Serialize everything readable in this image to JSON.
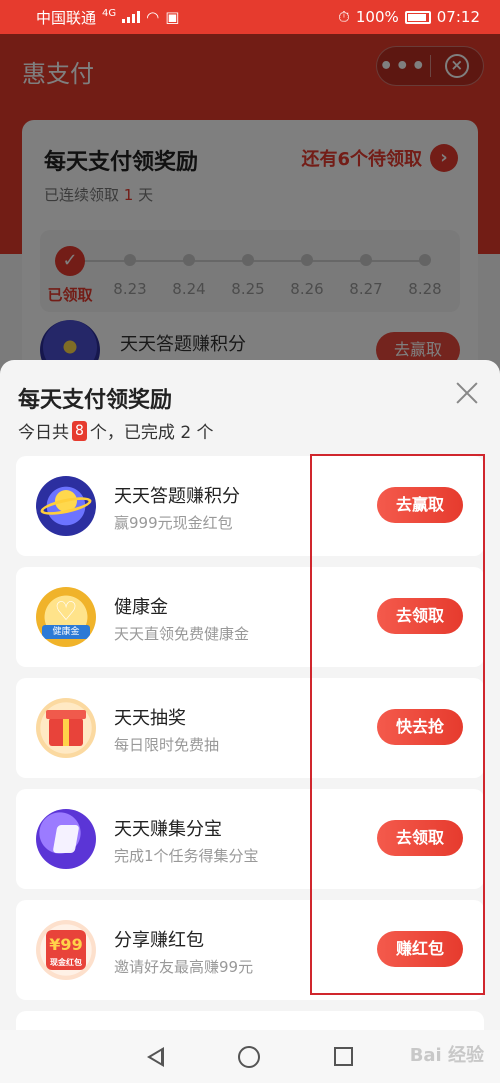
{
  "status_bar": {
    "carrier": "中国联通",
    "network": "4G",
    "battery": "100%",
    "time": "07:12"
  },
  "background_page": {
    "title": "惠支付",
    "card": {
      "title": "每天支付领奖励",
      "pending": "还有6个待领取",
      "streak_prefix": "已连续领取",
      "streak_days": "1",
      "streak_suffix": "天",
      "timeline": [
        {
          "label": "已领取",
          "done": true
        },
        {
          "label": "8.23",
          "done": false
        },
        {
          "label": "8.24",
          "done": false
        },
        {
          "label": "8.25",
          "done": false
        },
        {
          "label": "8.26",
          "done": false
        },
        {
          "label": "8.27",
          "done": false
        },
        {
          "label": "8.28",
          "done": false
        }
      ],
      "row": {
        "title": "天天答题赚积分",
        "button": "去赢取"
      }
    }
  },
  "sheet": {
    "title": "每天支付领奖励",
    "summary_prefix": "今日共",
    "summary_count": "8",
    "summary_suffix": "个，已完成 2 个",
    "tasks": [
      {
        "icon": "planet-icon",
        "title": "天天答题赚积分",
        "desc": "赢999元现金红包",
        "button": "去赢取"
      },
      {
        "icon": "health-coin-icon",
        "title": "健康金",
        "desc": "天天直领免费健康金",
        "button": "去领取",
        "icon_tag": "健康金"
      },
      {
        "icon": "gift-box-icon",
        "title": "天天抽奖",
        "desc": "每日限时免费抽",
        "button": "快去抢"
      },
      {
        "icon": "treasure-icon",
        "title": "天天赚集分宝",
        "desc": "完成1个任务得集分宝",
        "button": "去领取"
      },
      {
        "icon": "red-packet-icon",
        "title": "分享赚红包",
        "desc": "邀请好友最高赚99元",
        "button": "赚红包",
        "icon_text": "¥99",
        "icon_tag": "现金红包"
      }
    ]
  },
  "accent_color": "#e63b2e",
  "watermark": "Bai 经验"
}
